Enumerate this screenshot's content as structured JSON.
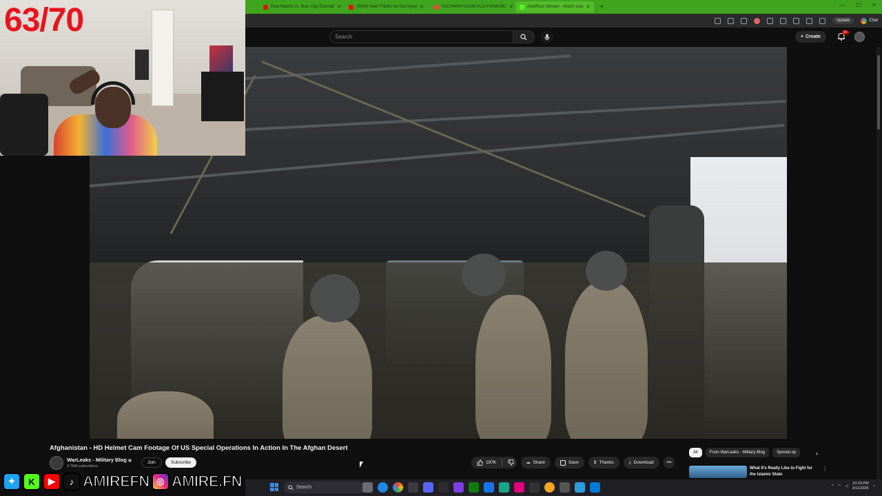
{
  "stream": {
    "counter": "63/70",
    "social_handle_1": "AMIREFN",
    "social_handle_2": "AMIRE.FN"
  },
  "browser": {
    "tabs": [
      {
        "label": "Real Madrid vs. Man. City Extende",
        "favicon_color": "#ff0000"
      },
      {
        "label": "(3854) Killer Thinks He Got Away",
        "favicon_color": "#ff0000"
      },
      {
        "label": "CcCHHHhY1WO6-VL1cYXNWXB1",
        "favicon_color": "#e24a3b"
      },
      {
        "label": "AdinRoss Stream - Watch Live",
        "favicon_color": "#53fc18"
      }
    ],
    "update_label": "Update",
    "chat_label": "Chat"
  },
  "youtube": {
    "search_placeholder": "Search",
    "create_label": "Create",
    "notification_count": "9+",
    "video": {
      "title": "Afghanistan - HD Helmet Cam Footage Of US Special Operations In Action In The Afghan Desert",
      "channel": "WarLeaks - Military Blog",
      "subscribers": "2.76M subscribers",
      "join_label": "Join",
      "subscribe_label": "Subscribe",
      "likes": "197K",
      "share_label": "Share",
      "save_label": "Save",
      "thanks_label": "Thanks",
      "download_label": "Download"
    },
    "chips": [
      "All",
      "From WarLeaks - Military Blog",
      "Special op"
    ],
    "recommendation": {
      "title": "What It's Really Like to Fight for the Islamic State"
    }
  },
  "taskbar": {
    "search_label": "Search",
    "time": "10:29 PM",
    "date": "3/11/2026"
  },
  "colors": {
    "tabstrip": "#3fa51e",
    "counter": "#e8141d",
    "yt_bg": "#0f0f0f"
  }
}
